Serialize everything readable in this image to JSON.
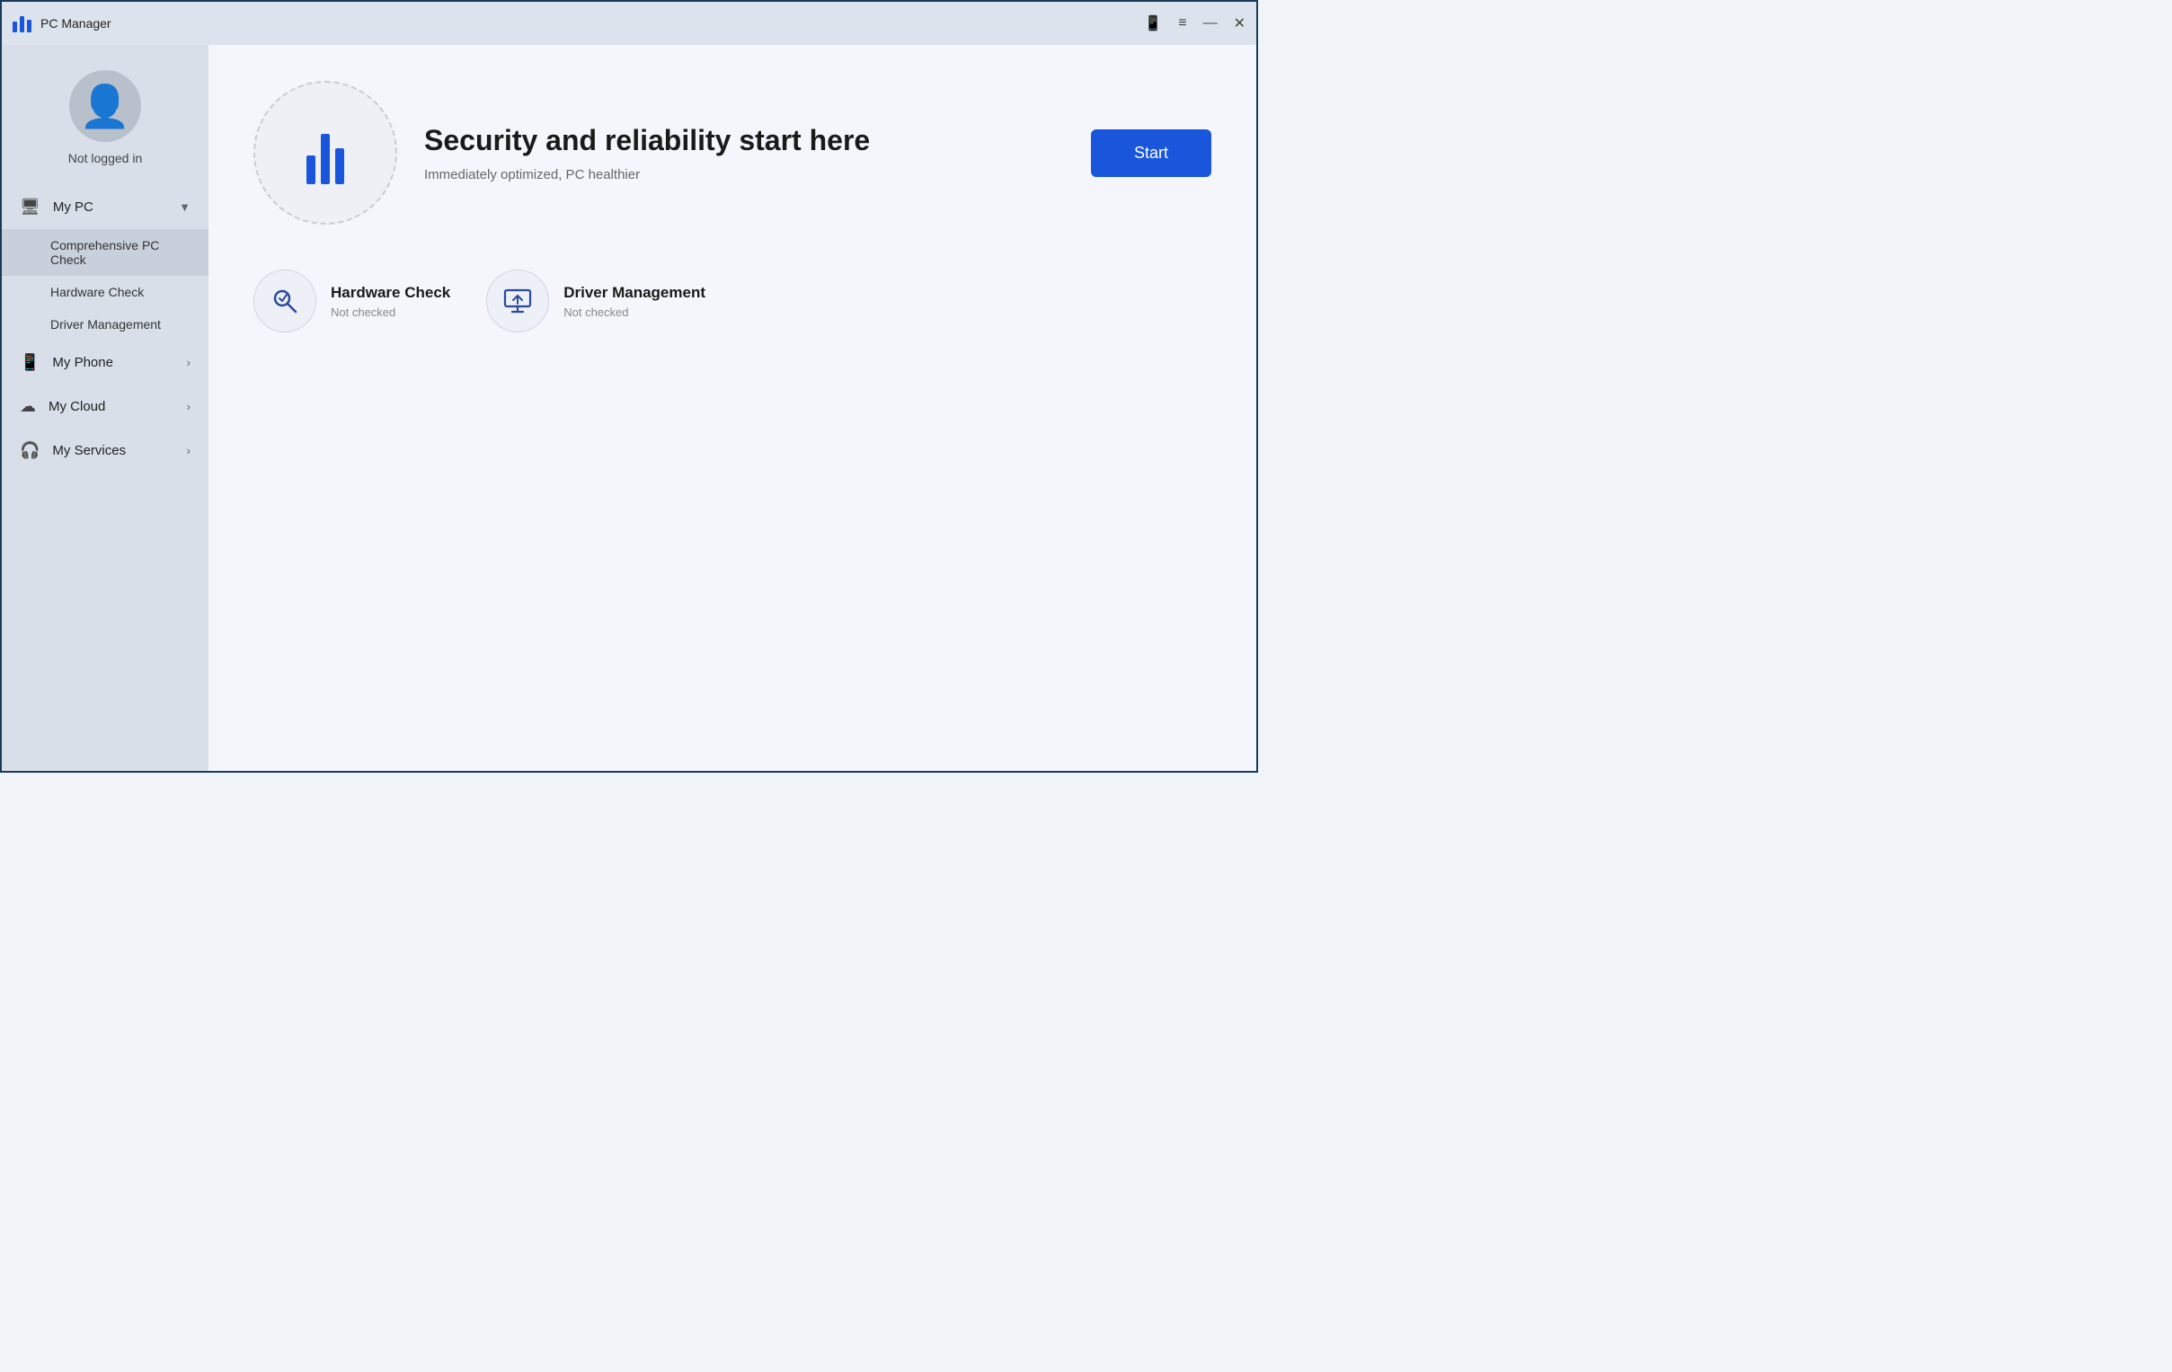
{
  "titlebar": {
    "logo_label": "PC Manager",
    "title": "PC Manager",
    "controls": {
      "phone_icon": "📱",
      "menu_icon": "≡",
      "minimize_icon": "—",
      "close_icon": "✕"
    }
  },
  "sidebar": {
    "user": {
      "status": "Not logged in"
    },
    "nav": [
      {
        "id": "my-pc",
        "label": "My PC",
        "icon": "laptop",
        "chevron": "▼",
        "expanded": true,
        "subitems": [
          {
            "id": "comprehensive-pc-check",
            "label": "Comprehensive PC Check",
            "active": true
          },
          {
            "id": "hardware-check",
            "label": "Hardware Check",
            "active": false
          },
          {
            "id": "driver-management",
            "label": "Driver Management",
            "active": false
          }
        ]
      },
      {
        "id": "my-phone",
        "label": "My Phone",
        "icon": "phone",
        "chevron": "›",
        "expanded": false
      },
      {
        "id": "my-cloud",
        "label": "My Cloud",
        "icon": "cloud",
        "chevron": "›",
        "expanded": false
      },
      {
        "id": "my-services",
        "label": "My Services",
        "icon": "headset",
        "chevron": "›",
        "expanded": false
      }
    ]
  },
  "content": {
    "hero": {
      "title": "Security and reliability start here",
      "subtitle": "Immediately optimized, PC healthier",
      "start_button": "Start"
    },
    "cards": [
      {
        "id": "hardware-check",
        "title": "Hardware Check",
        "status": "Not checked"
      },
      {
        "id": "driver-management",
        "title": "Driver Management",
        "status": "Not checked"
      }
    ]
  }
}
